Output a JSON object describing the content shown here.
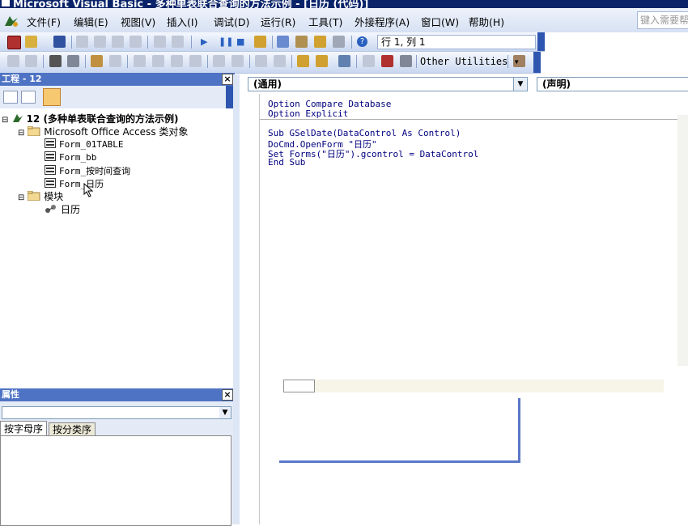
{
  "window": {
    "title": "Microsoft Visual Basic - 多种单表联合查询的方法示例 - [日历 (代码)]"
  },
  "menu": {
    "items": [
      "文件(F)",
      "编辑(E)",
      "视图(V)",
      "插入(I)",
      "调试(D)",
      "运行(R)",
      "工具(T)",
      "外接程序(A)",
      "窗口(W)",
      "帮助(H)"
    ],
    "search_placeholder": "键入需要帮"
  },
  "toolbar": {
    "position_text": "行 1, 列 1",
    "other_utilities": "Other Utilities"
  },
  "project": {
    "title": "工程 - 12",
    "root": "12 (多种单表联合查询的方法示例)",
    "folder_objects": "Microsoft Office Access 类对象",
    "forms": [
      "Form_01TABLE",
      "Form_bb",
      "Form_按时间查询",
      "Form_日历"
    ],
    "folder_modules": "模块",
    "module": "日历"
  },
  "properties": {
    "title": "属性",
    "tab_alpha": "按字母序",
    "tab_category": "按分类序"
  },
  "code": {
    "object_combo": "(通用)",
    "proc_combo": "(声明)",
    "lines": [
      "Option Compare Database",
      "Option Explicit",
      "",
      "Sub GSelDate(DataControl As Control)",
      "DoCmd.OpenForm \"日历\"",
      "Set Forms(\"日历\").gcontrol = DataControl",
      "End Sub"
    ]
  },
  "colors": {
    "title_bar": "#0a246a",
    "keyword": "#00007f",
    "selection": "#316ac5"
  }
}
